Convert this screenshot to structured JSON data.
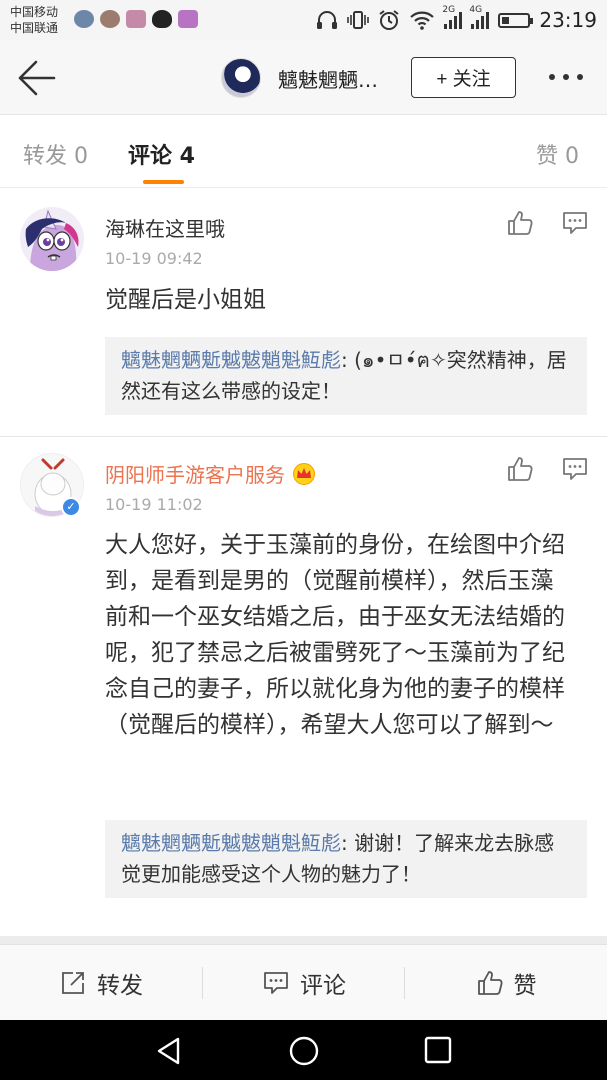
{
  "status_bar": {
    "carrier_1": "中国移动",
    "carrier_2": "中国联通",
    "sim_1": "2G",
    "sim_2": "4G",
    "battery_level": 0.3,
    "time": "23:19"
  },
  "nav": {
    "title": "魑魅魍魉…",
    "follow_label": "+ 关注"
  },
  "tabs": [
    {
      "label": "转发 0"
    },
    {
      "label": "评论 4"
    },
    {
      "label": "赞 0"
    }
  ],
  "comments": [
    {
      "user": "海琳在这里哦",
      "time": "10-19 09:42",
      "text": "觉醒后是小姐姐",
      "reply": {
        "author": "魑魅魍魉鬿魆魃魈魁魱彪",
        "text": ": (๑•ㅁ•́ฅ✧突然精神，居然还有这么带感的设定！"
      }
    },
    {
      "user": "阴阳师手游客户服务",
      "time": "10-19 11:02",
      "text": "大人您好，关于玉藻前的身份，在绘图中介绍到，是看到是男的（觉醒前模样），然后玉藻前和一个巫女结婚之后，由于巫女无法结婚的呢，犯了禁忌之后被雷劈死了～玉藻前为了纪念自己的妻子，所以就化身为他的妻子的模样（觉醒后的模样），希望大人您可以了解到～",
      "reply": {
        "author": "魑魅魍魉鬿魆魃魈魁魱彪",
        "text": ": 谢谢！了解来龙去脉感觉更加能感受这个人物的魅力了！"
      }
    }
  ],
  "actions": {
    "repost": "转发",
    "comment": "评论",
    "like": "赞"
  },
  "colors": {
    "accent_orange": "#ff8200",
    "vip_name": "#eb7350",
    "reply_link": "#5a7bab"
  }
}
